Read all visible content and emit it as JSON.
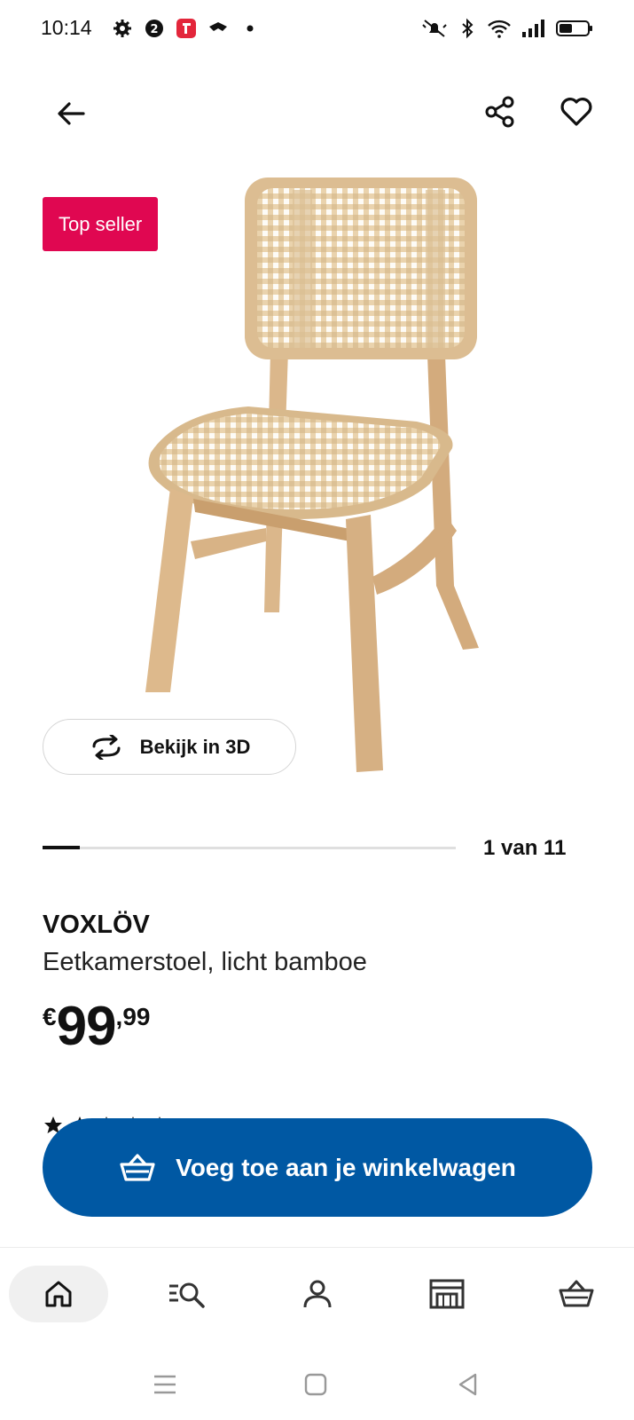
{
  "status_bar": {
    "time": "10:14",
    "left_icons": [
      "gear-icon",
      "notification-app-icon",
      "music-app-icon",
      "glasses-app-icon",
      "dot-icon"
    ],
    "right_icons": [
      "mute-icon",
      "bluetooth-icon",
      "wifi-icon",
      "signal-icon",
      "battery-icon"
    ]
  },
  "header": {
    "back_icon": "arrow-left-icon",
    "share_icon": "share-icon",
    "favorite_icon": "heart-icon"
  },
  "product": {
    "badge": "Top seller",
    "image": "chair-photo",
    "view_3d_label": "Bekijk in 3D",
    "gallery": {
      "current": 1,
      "total": 11,
      "counter_text": "1 van 11"
    },
    "name": "VOXLÖV",
    "description": "Eetkamerstoel, licht bamboe",
    "price": {
      "currency": "€",
      "integer": "99",
      "decimal": ",99"
    }
  },
  "cart_button": {
    "label": "Voeg toe aan je winkelwagen",
    "icon": "basket-icon"
  },
  "bottom_nav": {
    "items": [
      {
        "name": "home",
        "icon": "home-icon",
        "active": true
      },
      {
        "name": "search",
        "icon": "search-list-icon",
        "active": false
      },
      {
        "name": "account",
        "icon": "person-icon",
        "active": false
      },
      {
        "name": "stores",
        "icon": "store-icon",
        "active": false
      },
      {
        "name": "cart",
        "icon": "basket-icon",
        "active": false
      }
    ]
  },
  "colors": {
    "brand_blue": "#0058a3",
    "badge_pink": "#e00751",
    "text": "#111111"
  }
}
